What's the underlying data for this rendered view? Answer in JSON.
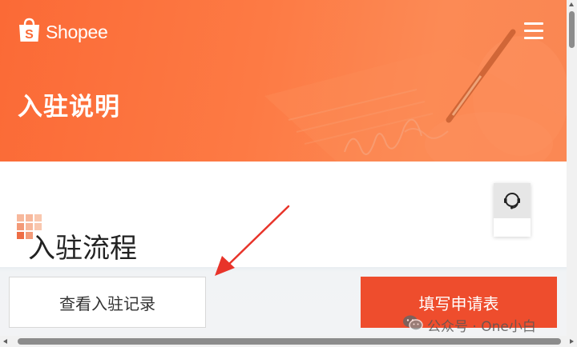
{
  "header": {
    "brand": "Shopee",
    "title": "入驻说明"
  },
  "section": {
    "title": "入驻流程"
  },
  "actions": {
    "history_label": "查看入驻记录",
    "apply_label": "填写申请表"
  },
  "watermark": {
    "text": "公众号 · One小白"
  },
  "icons": {
    "logo": "shopee-bag-icon",
    "menu": "hamburger-menu-icon",
    "support": "headset-icon",
    "section": "grid-dots-icon",
    "watermark": "wechat-icon"
  },
  "colors": {
    "brand_orange": "#fb6a36",
    "primary_button": "#ee4d2d",
    "annotation_arrow": "#e8342a"
  }
}
